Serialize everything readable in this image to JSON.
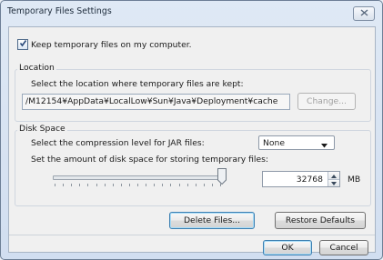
{
  "window": {
    "title": "Temporary Files Settings",
    "close_icon": "close-icon"
  },
  "keep_files": {
    "label": "Keep temporary files on my computer.",
    "checked": true
  },
  "location": {
    "legend": "Location",
    "prompt": "Select the location where temporary files are kept:",
    "path": "/M12154¥AppData¥LocalLow¥Sun¥Java¥Deployment¥cache",
    "change_button": "Change..."
  },
  "disk_space": {
    "legend": "Disk Space",
    "compression_label": "Select the compression level for JAR files:",
    "compression_value": "None",
    "amount_label": "Set the amount of disk space for storing temporary files:",
    "amount_value": "32768",
    "unit": "MB",
    "slider_level": 1.0
  },
  "buttons": {
    "delete_files": "Delete Files...",
    "restore_defaults": "Restore Defaults",
    "ok": "OK",
    "cancel": "Cancel"
  }
}
